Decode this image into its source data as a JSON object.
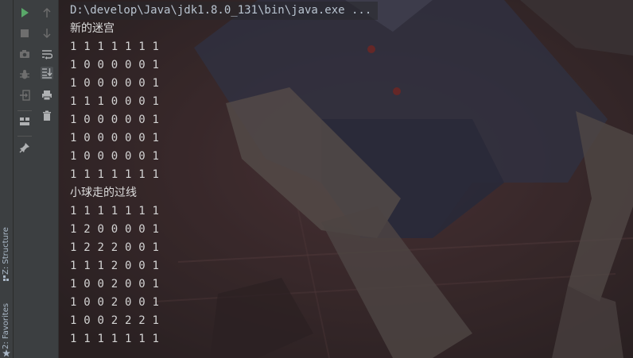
{
  "left_strip": {
    "structure_tab": "Z: Structure",
    "favorites_tab": "2: Favorites"
  },
  "run_toolbar": {
    "buttons": [
      "rerun-icon",
      "stop-icon",
      "camera-icon",
      "debug-icon",
      "exit-icon",
      "layout-icon",
      "pin-icon"
    ]
  },
  "console_toolbar": {
    "buttons": [
      "up-arrow-icon",
      "down-arrow-icon",
      "soft-wrap-icon",
      "scroll-to-end-icon",
      "print-icon",
      "trash-icon"
    ]
  },
  "console": {
    "command": "D:\\develop\\Java\\jdk1.8.0_131\\bin\\java.exe ...",
    "heading_new_maze": "新的迷宫",
    "new_maze_rows": [
      "1 1 1 1 1 1 1",
      "1 0 0 0 0 0 1",
      "1 0 0 0 0 0 1",
      "1 1 1 0 0 0 1",
      "1 0 0 0 0 0 1",
      "1 0 0 0 0 0 1",
      "1 0 0 0 0 0 1",
      "1 1 1 1 1 1 1"
    ],
    "heading_path": "小球走的过线",
    "path_rows": [
      "1 1 1 1 1 1 1",
      "1 2 0 0 0 0 1",
      "1 2 2 2 0 0 1",
      "1 1 1 2 0 0 1",
      "1 0 0 2 0 0 1",
      "1 0 0 2 0 0 1",
      "1 0 0 2 2 2 1",
      "1 1 1 1 1 1 1"
    ]
  },
  "colors": {
    "run_green": "#59a869",
    "toolbar_bg": "#3c3f41",
    "icon_gray": "#afb1b3"
  }
}
